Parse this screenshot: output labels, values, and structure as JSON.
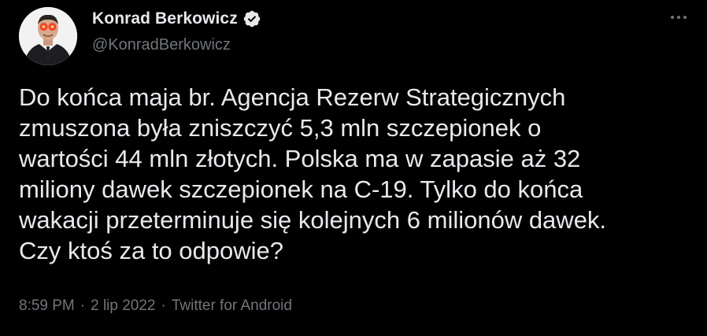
{
  "author": {
    "display_name": "Konrad Berkowicz",
    "handle": "@KonradBerkowicz",
    "verified": true
  },
  "icons": {
    "verified": "verified-badge-icon",
    "more": "more-options-icon"
  },
  "tweet": {
    "text": "Do końca maja br. Agencja Rezerw Strategicznych\nzmuszona była zniszczyć 5,3 mln szczepionek o\nwartości 44 mln złotych. Polska ma w zapasie aż 32\nmiliony dawek szczepionek na C-19. Tylko do końca\nwakacji przeterminuje się kolejnych 6 milionów dawek.\nCzy ktoś za to odpowie?",
    "time": "8:59 PM",
    "separator": "·",
    "date": "2 lip 2022",
    "source": "Twitter for Android"
  },
  "colors": {
    "background": "#000000",
    "primary_text": "#e7e9ea",
    "secondary_text": "#71767b",
    "verified": "#e7e9ea"
  }
}
